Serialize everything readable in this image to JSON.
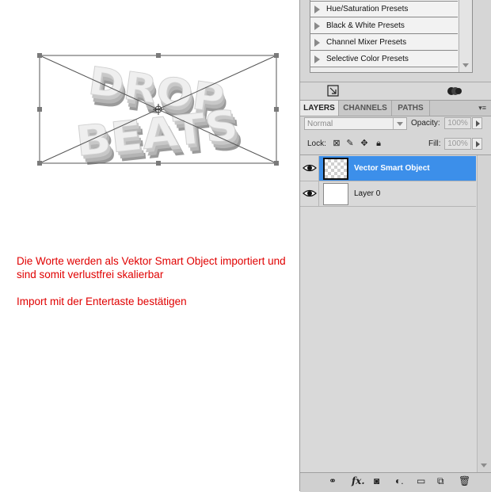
{
  "canvas": {
    "title_line1": "DROP",
    "title_line2": "BEATS",
    "caption_line1": "Die Worte werden als Vektor Smart Object importiert und",
    "caption_line2": "sind somit verlustfrei skalierbar",
    "caption_line3": "Import mit der Entertaste bestätigen",
    "caption_color": "#e00000"
  },
  "presets": {
    "items": [
      {
        "label": "Hue/Saturation Presets"
      },
      {
        "label": "Black & White Presets"
      },
      {
        "label": "Channel Mixer Presets"
      },
      {
        "label": "Selective Color Presets"
      }
    ]
  },
  "tabs": [
    {
      "label": "LAYERS",
      "active": true
    },
    {
      "label": "CHANNELS",
      "active": false
    },
    {
      "label": "PATHS",
      "active": false
    }
  ],
  "layers_panel": {
    "blend_mode": "Normal",
    "opacity_label": "Opacity:",
    "opacity_value": "100%",
    "lock_label": "Lock:",
    "fill_label": "Fill:",
    "fill_value": "100%",
    "layers": [
      {
        "name": "Vector Smart Object",
        "selected": true,
        "visible": true
      },
      {
        "name": "Layer 0",
        "selected": false,
        "visible": true
      }
    ],
    "bottom_icons": [
      "link-icon",
      "fx-icon",
      "mask-icon",
      "adjustment-icon",
      "folder-icon",
      "new-layer-icon",
      "trash-icon"
    ]
  },
  "colors": {
    "selection": "#3c8fea",
    "panel": "#d6d6d6"
  }
}
